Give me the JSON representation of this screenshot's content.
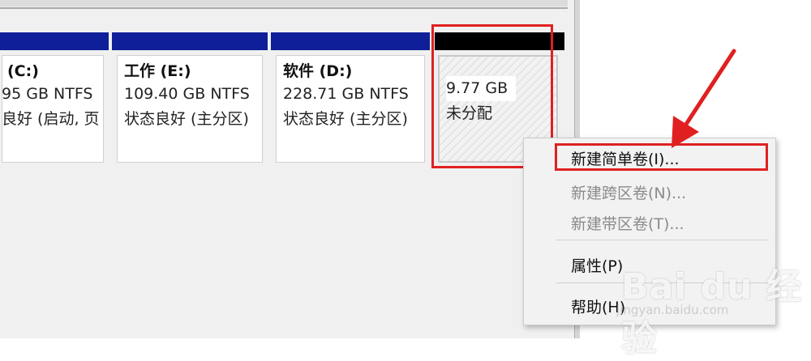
{
  "partitions": [
    {
      "name": "(C:)",
      "size": "95 GB NTFS",
      "status": "良好 (启动, 页",
      "header_color": "#0f1f9a"
    },
    {
      "name": "工作 (E:)",
      "size": "109.40 GB NTFS",
      "status": "状态良好 (主分区)",
      "header_color": "#0f1f9a"
    },
    {
      "name": "软件 (D:)",
      "size": "228.71 GB NTFS",
      "status": "状态良好 (主分区)",
      "header_color": "#0f1f9a"
    },
    {
      "size": "9.77 GB",
      "status": "未分配",
      "header_color": "#000000"
    }
  ],
  "context_menu": {
    "items": [
      {
        "label": "新建简单卷(I)...",
        "enabled": true
      },
      {
        "label": "新建跨区卷(N)...",
        "enabled": false
      },
      {
        "label": "新建带区卷(T)...",
        "enabled": false
      },
      {
        "label": "属性(P)",
        "enabled": true
      },
      {
        "label": "帮助(H)",
        "enabled": true
      }
    ]
  },
  "watermark": {
    "brand": "Bai du 经验",
    "url": "jingyan.baidu.com"
  },
  "colors": {
    "highlight": "#e02020",
    "volume_header": "#0f1f9a",
    "unallocated_header": "#000000"
  }
}
